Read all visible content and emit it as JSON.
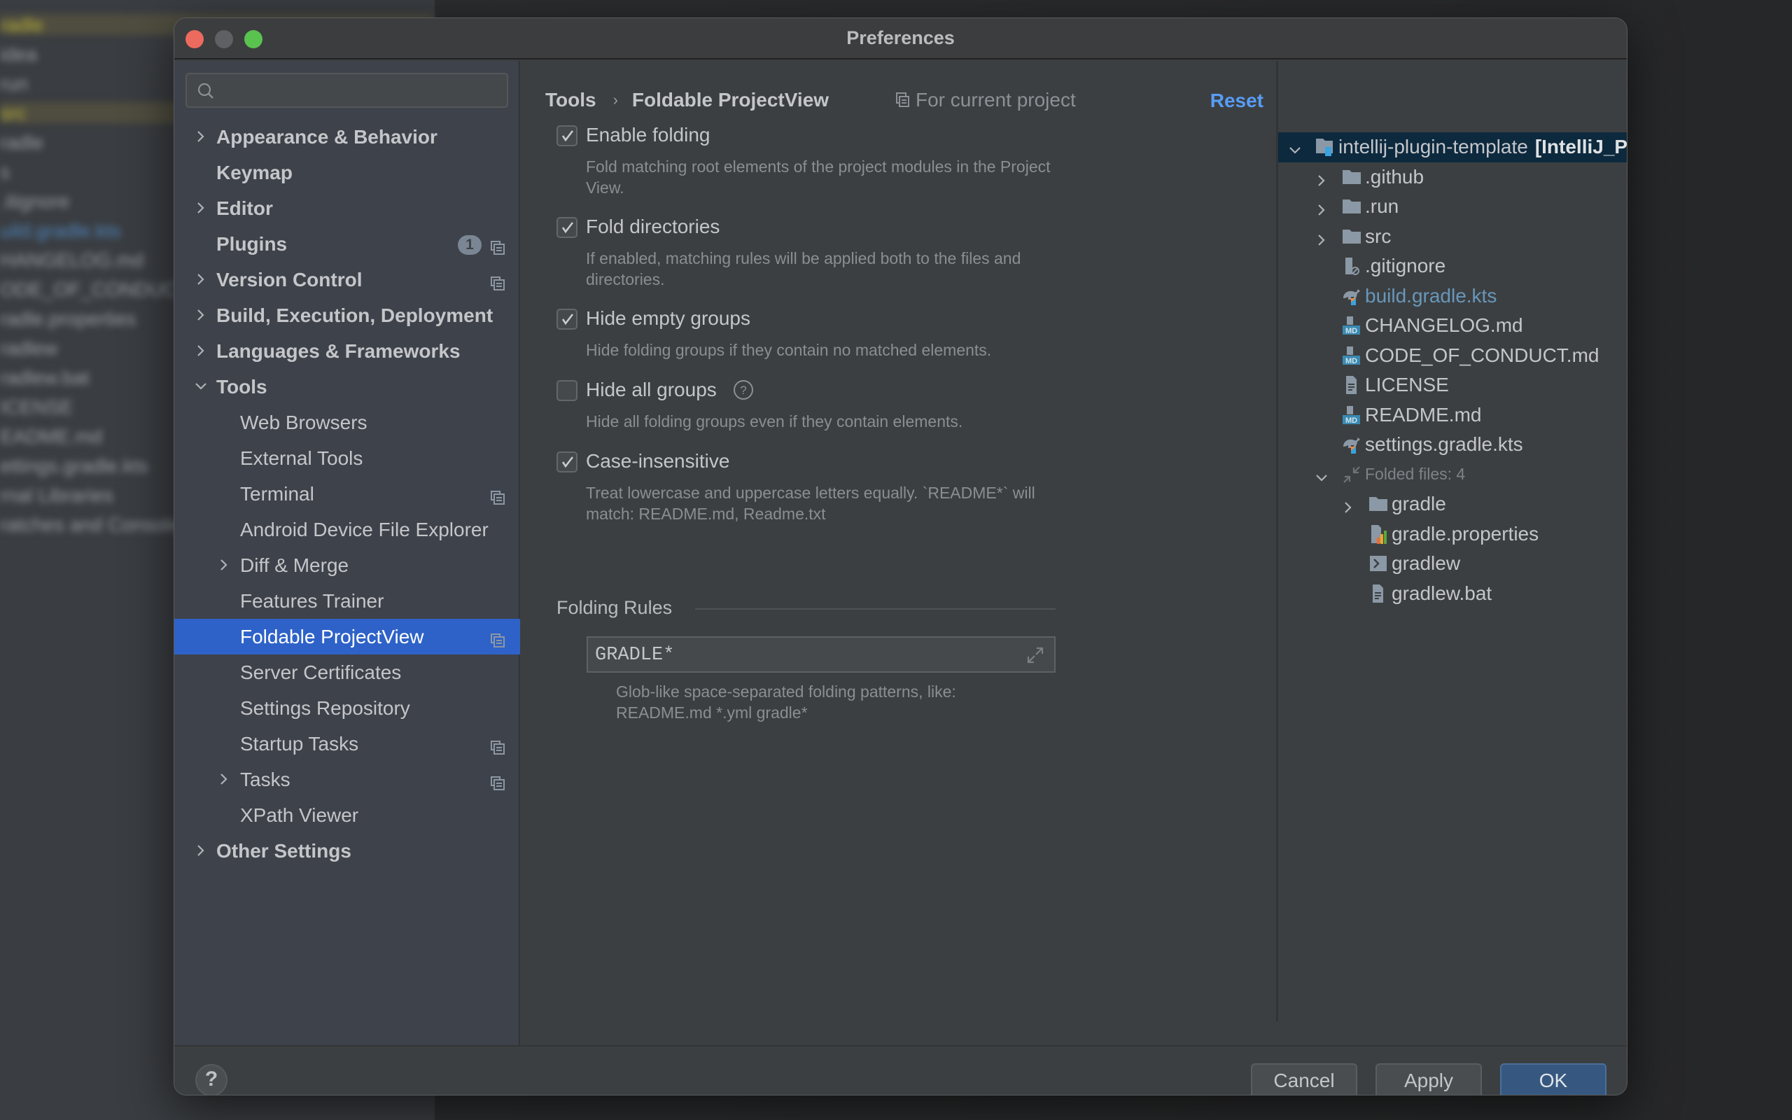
{
  "window": {
    "title": "Preferences"
  },
  "background": {
    "rows": [
      {
        "text": "radle",
        "style": "yellow hl"
      },
      {
        "text": "idea",
        "style": ""
      },
      {
        "text": "run",
        "style": ""
      },
      {
        "text": "src",
        "style": "yellow hl"
      },
      {
        "text": "radle",
        "style": ""
      },
      {
        "text": "s",
        "style": ""
      },
      {
        "text": ".itignore",
        "style": ""
      },
      {
        "text": "uild.gradle.kts",
        "style": "blue"
      },
      {
        "text": "HANGELOG.md",
        "style": ""
      },
      {
        "text": "ODE_OF_CONDUCT.md",
        "style": ""
      },
      {
        "text": "radle.properties",
        "style": ""
      },
      {
        "text": "radlew",
        "style": ""
      },
      {
        "text": "radlew.bat",
        "style": ""
      },
      {
        "text": "ICENSE",
        "style": ""
      },
      {
        "text": "EADME.md",
        "style": ""
      },
      {
        "text": "ettings.gradle.kts",
        "style": ""
      },
      {
        "text": "rnal Libraries",
        "style": ""
      },
      {
        "text": "ratches and Consoles",
        "style": ""
      }
    ]
  },
  "sidebar": {
    "search": {
      "value": "",
      "placeholder": ""
    },
    "items": [
      {
        "label": "Appearance & Behavior",
        "level": 0,
        "chevron": "right"
      },
      {
        "label": "Keymap",
        "level": 0,
        "chevron": ""
      },
      {
        "label": "Editor",
        "level": 0,
        "chevron": "right"
      },
      {
        "label": "Plugins",
        "level": 0,
        "chevron": "",
        "badge": "1",
        "project_icon": true
      },
      {
        "label": "Version Control",
        "level": 0,
        "chevron": "right",
        "project_icon": true
      },
      {
        "label": "Build, Execution, Deployment",
        "level": 0,
        "chevron": "right"
      },
      {
        "label": "Languages & Frameworks",
        "level": 0,
        "chevron": "right"
      },
      {
        "label": "Tools",
        "level": 0,
        "chevron": "down"
      },
      {
        "label": "Web Browsers",
        "level": 1,
        "chevron": ""
      },
      {
        "label": "External Tools",
        "level": 1,
        "chevron": ""
      },
      {
        "label": "Terminal",
        "level": 1,
        "chevron": "",
        "project_icon": true
      },
      {
        "label": "Android Device File Explorer",
        "level": 1,
        "chevron": ""
      },
      {
        "label": "Diff & Merge",
        "level": 1,
        "chevron": "right"
      },
      {
        "label": "Features Trainer",
        "level": 1,
        "chevron": ""
      },
      {
        "label": "Foldable ProjectView",
        "level": 1,
        "chevron": "",
        "project_icon": true,
        "selected": true
      },
      {
        "label": "Server Certificates",
        "level": 1,
        "chevron": ""
      },
      {
        "label": "Settings Repository",
        "level": 1,
        "chevron": ""
      },
      {
        "label": "Startup Tasks",
        "level": 1,
        "chevron": "",
        "project_icon": true
      },
      {
        "label": "Tasks",
        "level": 1,
        "chevron": "right",
        "project_icon": true
      },
      {
        "label": "XPath Viewer",
        "level": 1,
        "chevron": ""
      },
      {
        "label": "Other Settings",
        "level": 0,
        "chevron": "right"
      }
    ]
  },
  "header": {
    "breadcrumb": [
      "Tools",
      "Foldable ProjectView"
    ],
    "breadcrumb_separator": "›",
    "scope_label": "For current project",
    "reset_label": "Reset"
  },
  "options": [
    {
      "label": "Enable folding",
      "checked": true,
      "description": "Fold matching root elements of the project modules in the Project View."
    },
    {
      "label": "Fold directories",
      "checked": true,
      "description": "If enabled, matching rules will be applied both to the files and directories."
    },
    {
      "label": "Hide empty groups",
      "checked": true,
      "description": "Hide folding groups if they contain no matched elements."
    },
    {
      "label": "Hide all groups",
      "checked": false,
      "help": true,
      "description": "Hide all folding groups even if they contain elements."
    },
    {
      "label": "Case-insensitive",
      "checked": true,
      "description": "Treat lowercase and uppercase letters equally. `README*` will match: README.md, Readme.txt"
    }
  ],
  "folding_rules": {
    "title": "Folding Rules",
    "value": "GRADLE*",
    "description": "Glob-like space-separated folding patterns, like: README.md *.yml gradle*"
  },
  "tree": {
    "rows": [
      {
        "label": "intellij-plugin-template",
        "suffix": "[IntelliJ_Platform_Plugin",
        "icon": "module",
        "depth": 0,
        "chevron": "down",
        "root": true
      },
      {
        "label": ".github",
        "icon": "folder",
        "depth": 1,
        "chevron": "right"
      },
      {
        "label": ".run",
        "icon": "folder",
        "depth": 1,
        "chevron": "right"
      },
      {
        "label": "src",
        "icon": "folder",
        "depth": 1,
        "chevron": "right"
      },
      {
        "label": ".gitignore",
        "icon": "ignore-file",
        "depth": 1,
        "chevron": ""
      },
      {
        "label": "build.gradle.kts",
        "icon": "gradle-kts",
        "depth": 1,
        "chevron": "",
        "modified": true
      },
      {
        "label": "CHANGELOG.md",
        "icon": "markdown",
        "depth": 1,
        "chevron": ""
      },
      {
        "label": "CODE_OF_CONDUCT.md",
        "icon": "markdown",
        "depth": 1,
        "chevron": ""
      },
      {
        "label": "LICENSE",
        "icon": "text-file",
        "depth": 1,
        "chevron": ""
      },
      {
        "label": "README.md",
        "icon": "markdown",
        "depth": 1,
        "chevron": ""
      },
      {
        "label": "settings.gradle.kts",
        "icon": "gradle-kts",
        "depth": 1,
        "chevron": ""
      },
      {
        "label": "Folded files: 4",
        "icon": "folded",
        "depth": 1,
        "chevron": "down",
        "dim": true
      },
      {
        "label": "gradle",
        "icon": "folder",
        "depth": 2,
        "chevron": "right"
      },
      {
        "label": "gradle.properties",
        "icon": "properties",
        "depth": 2,
        "chevron": ""
      },
      {
        "label": "gradlew",
        "icon": "shell",
        "depth": 2,
        "chevron": ""
      },
      {
        "label": "gradlew.bat",
        "icon": "text-file",
        "depth": 2,
        "chevron": ""
      }
    ]
  },
  "footer": {
    "help_label": "?",
    "cancel_label": "Cancel",
    "apply_label": "Apply",
    "ok_label": "OK"
  },
  "colors": {
    "accent": "#2e62c8",
    "link": "#589df6",
    "ok_button": "#365880",
    "modified_file": "#6897bb"
  }
}
